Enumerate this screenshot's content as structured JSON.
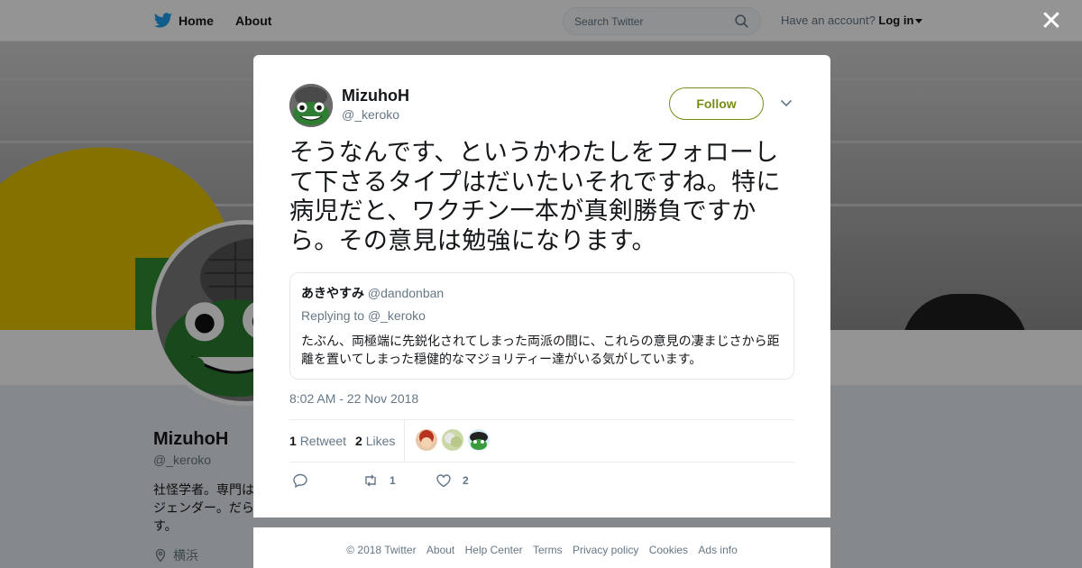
{
  "topbar": {
    "home_label": "Home",
    "about_label": "About",
    "search_placeholder": "Search Twitter",
    "account_prompt": "Have an account?",
    "login_label": "Log in"
  },
  "profile": {
    "name": "MizuhoH",
    "handle": "@_keroko",
    "bio": "社怪学者。専門は\nジェンダー。だら\nす。",
    "location": "横浜"
  },
  "tweet": {
    "author_name": "MizuhoH",
    "author_handle": "@_keroko",
    "follow_label": "Follow",
    "text": "そうなんです、というかわたしをフォローして下さるタイプはだいたいそれですね。特に病児だと、ワクチン一本が真剣勝負ですから。その意見は勉強になります。",
    "quoted": {
      "name": "あきやすみ",
      "handle": "@dandonban",
      "replying_prefix": "Replying to",
      "replying_handle": "@_keroko",
      "text": "たぶん、両極端に先鋭化されてしまった両派の間に、これらの意見の凄まじさから距離を置いてしまった穏健的なマジョリティー達がいる気がしています。"
    },
    "timestamp": "8:02 AM - 22 Nov 2018",
    "retweet_count": "1",
    "retweet_label": "Retweet",
    "like_count": "2",
    "like_label": "Likes",
    "actions": {
      "reply_count": "",
      "retweet_count": "1",
      "like_count": "2"
    }
  },
  "footer": {
    "links": [
      "© 2018 Twitter",
      "About",
      "Help Center",
      "Terms",
      "Privacy policy",
      "Cookies",
      "Ads info"
    ]
  },
  "colors": {
    "accent": "#798c18",
    "twitter_blue": "#1da1f2",
    "secondary_text": "#657786"
  },
  "icons": [
    "twitter-bird-icon",
    "search-icon",
    "close-icon",
    "chevron-down-icon",
    "reply-icon",
    "retweet-icon",
    "heart-icon",
    "location-icon"
  ]
}
